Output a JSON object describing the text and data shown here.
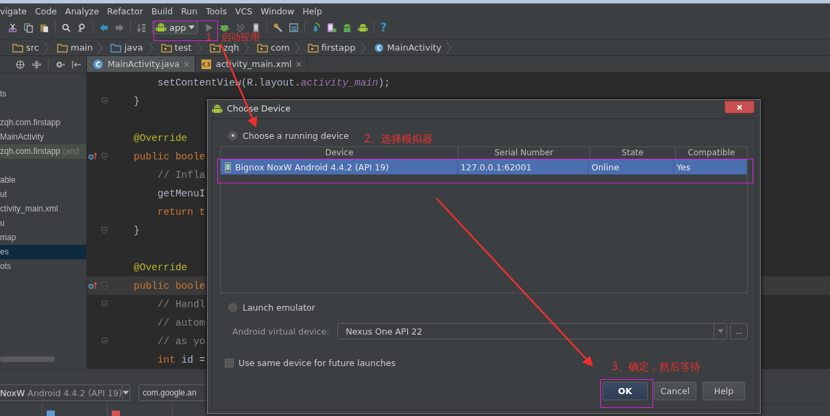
{
  "menu": [
    "vigate",
    "Code",
    "Analyze",
    "Refactor",
    "Build",
    "Run",
    "Tools",
    "VCS",
    "Window",
    "Help"
  ],
  "toolbar": {
    "run_config": "app",
    "help": "?"
  },
  "breadcrumb": [
    {
      "label": "src",
      "kind": "folder"
    },
    {
      "label": "main",
      "kind": "folder"
    },
    {
      "label": "java",
      "kind": "source"
    },
    {
      "label": "test",
      "kind": "package"
    },
    {
      "label": "zqh",
      "kind": "package"
    },
    {
      "label": "com",
      "kind": "package"
    },
    {
      "label": "firstapp",
      "kind": "package"
    },
    {
      "label": "MainActivity",
      "kind": "class"
    }
  ],
  "project_tree": [
    {
      "text": "ts",
      "selected": false,
      "highlighted": false
    },
    {
      "text": "zqh.com.firstapp",
      "selected": false,
      "highlighted": false
    },
    {
      "text": "MainActivity",
      "selected": false,
      "highlighted": false
    },
    {
      "text": "zqh.com.firstapp",
      "suffix": " (and",
      "selected": false,
      "highlighted": true
    },
    {
      "text": "able",
      "selected": false,
      "highlighted": false
    },
    {
      "text": "ut",
      "selected": false,
      "highlighted": false
    },
    {
      "text": "ctivity_main.xml",
      "selected": false,
      "highlighted": false
    },
    {
      "text": "u",
      "selected": false,
      "highlighted": false
    },
    {
      "text": "map",
      "selected": false,
      "highlighted": false
    },
    {
      "text": "es",
      "selected": true,
      "highlighted": false
    },
    {
      "text": "ots",
      "selected": false,
      "highlighted": false
    }
  ],
  "editor_tabs": [
    {
      "label": "MainActivity.java",
      "kind": "java",
      "selected": true
    },
    {
      "label": "activity_main.xml",
      "kind": "xml",
      "selected": false
    }
  ],
  "code_lines": [
    {
      "tokens": [
        {
          "text": "    setContentView(R.layout.",
          "kind": "plain"
        },
        {
          "text": "activity_main",
          "kind": "field"
        },
        {
          "text": ");",
          "kind": "plain"
        }
      ],
      "override_marker": false,
      "fold": false,
      "current": false
    },
    {
      "tokens": [
        {
          "text": "}",
          "kind": "plain"
        }
      ],
      "override_marker": false,
      "fold": true,
      "current": false
    },
    {
      "override_marker": false,
      "fold": false,
      "current": false
    },
    {
      "tokens": [
        {
          "text": "@Override",
          "kind": "annotation"
        }
      ],
      "override_marker": false,
      "fold": false,
      "current": false
    },
    {
      "tokens": [
        {
          "text": "public boole",
          "kind": "keyword"
        }
      ],
      "override_marker": true,
      "fold": true,
      "current": false
    },
    {
      "tokens": [
        {
          "text": "    // Infla",
          "kind": "comment"
        }
      ],
      "override_marker": false,
      "fold": false,
      "current": false
    },
    {
      "tokens": [
        {
          "text": "    getMenuI",
          "kind": "plain"
        }
      ],
      "override_marker": false,
      "fold": false,
      "current": false
    },
    {
      "tokens": [
        {
          "text": "    return t",
          "kind": "keyword"
        }
      ],
      "override_marker": false,
      "fold": false,
      "current": false
    },
    {
      "tokens": [
        {
          "text": "}",
          "kind": "plain"
        }
      ],
      "override_marker": false,
      "fold": true,
      "current": false
    },
    {
      "override_marker": false,
      "fold": false,
      "current": false
    },
    {
      "tokens": [
        {
          "text": "@Override",
          "kind": "annotation"
        }
      ],
      "override_marker": false,
      "fold": false,
      "current": false
    },
    {
      "tokens": [
        {
          "text": "public boole",
          "kind": "keyword"
        }
      ],
      "override_marker": true,
      "fold": true,
      "current": true
    },
    {
      "tokens": [
        {
          "text": "    // Handl",
          "kind": "comment"
        }
      ],
      "override_marker": false,
      "fold": true,
      "current": false
    },
    {
      "tokens": [
        {
          "text": "    // autom",
          "kind": "comment"
        }
      ],
      "override_marker": false,
      "fold": false,
      "current": false
    },
    {
      "tokens": [
        {
          "text": "    // as yo",
          "kind": "comment"
        }
      ],
      "override_marker": false,
      "fold": true,
      "current": false
    },
    {
      "tokens": [
        {
          "text": "    int",
          "kind": "keyword"
        },
        {
          "text": " id =",
          "kind": "plain"
        }
      ],
      "override_marker": false,
      "fold": false,
      "current": false
    }
  ],
  "device_bar": {
    "device_primary": "NoxW",
    "device_secondary": " Android 4.4.2 (API 19)",
    "process": "com.google.an"
  },
  "dialog": {
    "title": "Choose Device",
    "running_option": {
      "label": "Choose a running device",
      "selected": true
    },
    "table": {
      "columns": [
        "Device",
        "Serial Number",
        "State",
        "Compatible"
      ],
      "rows": [
        {
          "device": "Bignox NoxW Android 4.4.2 (API 19)",
          "serial": "127.0.0.1:62001",
          "state": "Online",
          "compatible": "Yes",
          "selected": true
        }
      ]
    },
    "emulator_option": {
      "label": "Launch emulator",
      "selected": false
    },
    "avd": {
      "label": "Android virtual device:",
      "value": "Nexus One API 22",
      "more": "..."
    },
    "reuse_checkbox": {
      "label": "Use same device for future launches",
      "checked": false
    },
    "buttons": [
      {
        "label": "OK",
        "default": true
      },
      {
        "label": "Cancel",
        "default": false
      },
      {
        "label": "Help",
        "default": false
      }
    ]
  },
  "annotations": [
    {
      "text": "1、启动应用"
    },
    {
      "text": "2、选择模拟器"
    },
    {
      "text": "3、确定，然后等待"
    }
  ]
}
